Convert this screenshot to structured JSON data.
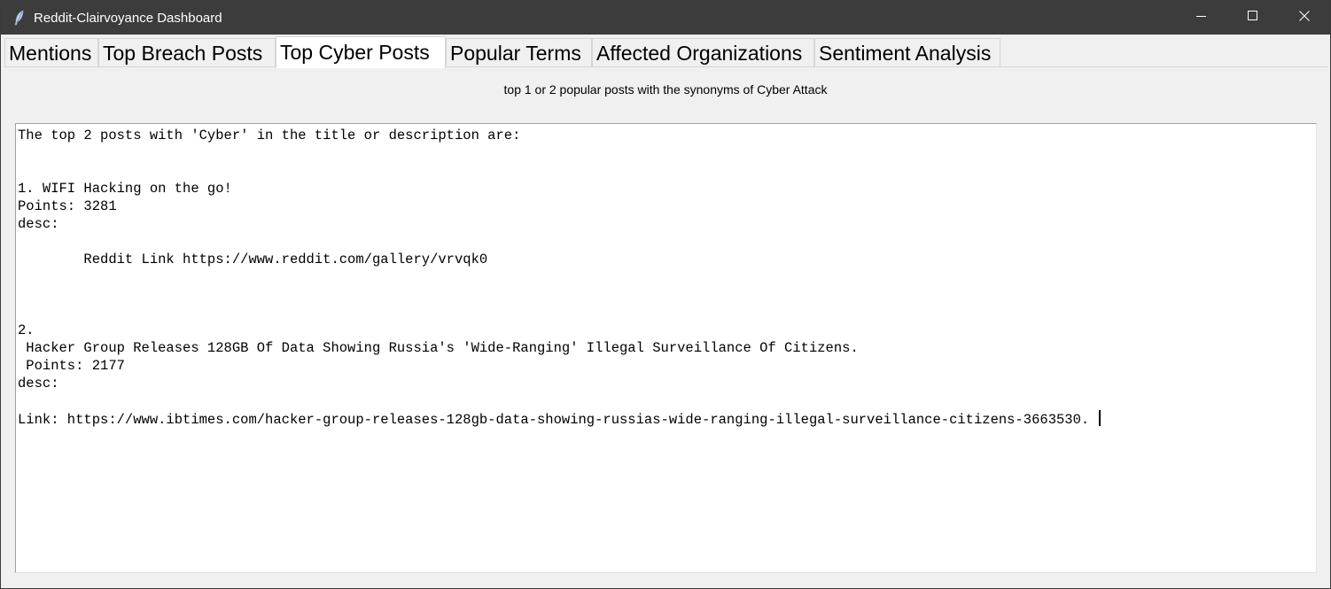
{
  "window": {
    "title": "Reddit-Clairvoyance Dashboard"
  },
  "titlebar_buttons": {
    "minimize_icon": "minimize-icon",
    "maximize_icon": "maximize-icon",
    "close_icon": "close-icon"
  },
  "tabs": [
    {
      "label": "Mentions",
      "active": false
    },
    {
      "label": "Top Breach Posts",
      "active": false
    },
    {
      "label": "Top Cyber Posts",
      "active": true
    },
    {
      "label": "Popular Terms",
      "active": false
    },
    {
      "label": "Affected Organizations",
      "active": false
    },
    {
      "label": "Sentiment Analysis",
      "active": false
    }
  ],
  "panel": {
    "subtitle": "top 1 or 2 popular posts with the synonyms of Cyber Attack",
    "output_text": "The top 2 posts with 'Cyber' in the title or description are:\n\n\n1. WIFI Hacking on the go!\nPoints: 3281\ndesc:\n\n        Reddit Link https://www.reddit.com/gallery/vrvqk0\n\n\n\n2.\n Hacker Group Releases 128GB Of Data Showing Russia's 'Wide-Ranging' Illegal Surveillance Of Citizens.\n Points: 2177\ndesc:\n\nLink: https://www.ibtimes.com/hacker-group-releases-128gb-data-showing-russias-wide-ranging-illegal-surveillance-citizens-3663530. "
  },
  "colors": {
    "titlebar_bg": "#3c3c3c",
    "window_bg": "#f0f0f0",
    "textarea_bg": "#ffffff"
  }
}
